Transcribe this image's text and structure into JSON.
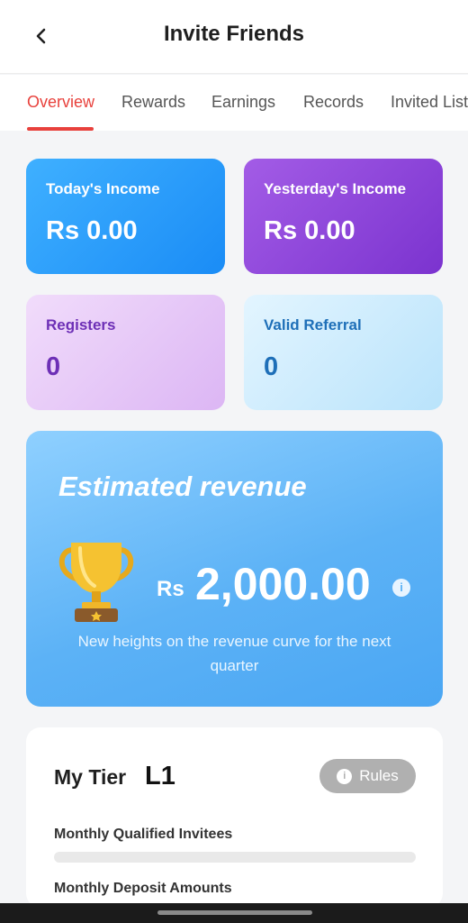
{
  "header": {
    "title": "Invite Friends",
    "back_icon": "chevron-left-icon"
  },
  "tabs": [
    {
      "label": "Overview",
      "active": true
    },
    {
      "label": "Rewards",
      "active": false
    },
    {
      "label": "Earnings",
      "active": false
    },
    {
      "label": "Records",
      "active": false
    },
    {
      "label": "Invited List",
      "active": false
    }
  ],
  "stats": {
    "today": {
      "label": "Today's Income",
      "value": "Rs 0.00"
    },
    "yesterday": {
      "label": "Yesterday's Income",
      "value": "Rs 0.00"
    },
    "registers": {
      "label": "Registers",
      "value": "0"
    },
    "valid": {
      "label": "Valid Referral",
      "value": "0"
    }
  },
  "estimated": {
    "title": "Estimated revenue",
    "currency": "Rs",
    "amount": "2,000.00",
    "info_icon": "info-icon",
    "trophy_icon": "trophy-icon",
    "description": "New heights on the revenue curve for the next quarter"
  },
  "tier": {
    "title": "My Tier",
    "level": "L1",
    "rules_label": "Rules",
    "qualified_label": "Monthly Qualified Invitees",
    "qualified_progress": 0,
    "deposit_label": "Monthly Deposit Amounts"
  },
  "colors": {
    "accent": "#e8413c",
    "today_card": "#2b9cfa",
    "yesterday_card": "#8d44d9",
    "registers_card": "#e5c8f7",
    "valid_card": "#cfeeff",
    "estimated_card": "#6dbcf7"
  }
}
